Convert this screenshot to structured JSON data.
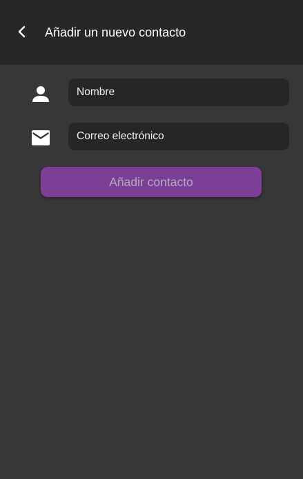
{
  "header": {
    "title": "Añadir un nuevo contacto",
    "back_icon": "chevron-left-icon"
  },
  "form": {
    "name_field": {
      "icon": "person-icon",
      "placeholder": "Nombre",
      "value": ""
    },
    "email_field": {
      "icon": "mail-icon",
      "placeholder": "Correo electrónico",
      "value": ""
    },
    "submit_label": "Añadir contacto"
  },
  "colors": {
    "background": "#373737",
    "header_background": "#272727",
    "field_background": "#262626",
    "button_background": "#7b3f96",
    "button_text": "#b9a8c1"
  }
}
